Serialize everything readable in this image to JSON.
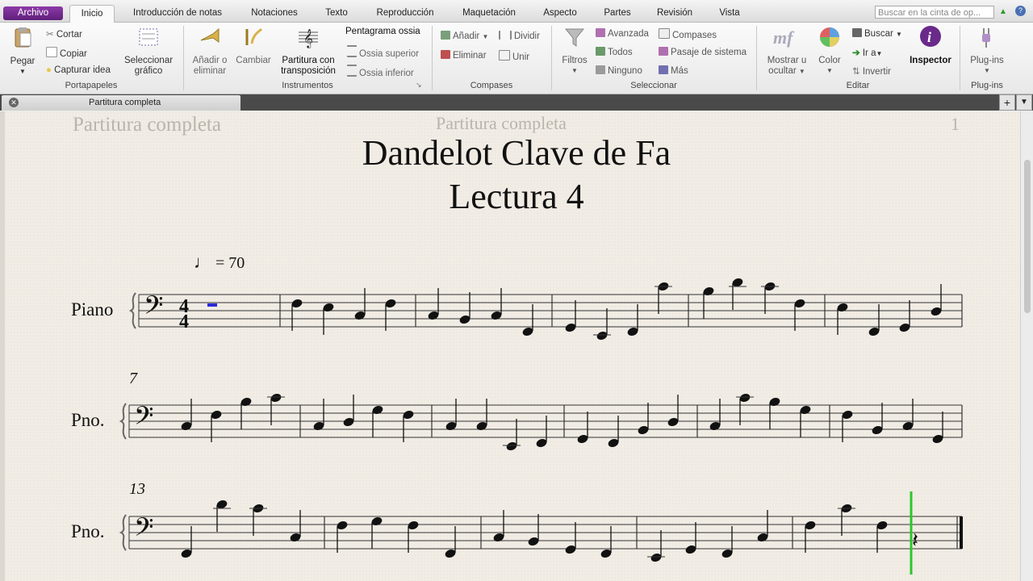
{
  "ribbon_tabs": [
    "Archivo",
    "Inicio",
    "Introducción de notas",
    "Notaciones",
    "Texto",
    "Reproducción",
    "Maquetación",
    "Aspecto",
    "Partes",
    "Revisión",
    "Vista"
  ],
  "search_placeholder": "Buscar en la cinta de op...",
  "groups": {
    "portapapeles": {
      "label": "Portapapeles",
      "pegar": "Pegar",
      "cortar": "Cortar",
      "copiar": "Copiar",
      "capturar": "Capturar idea",
      "seleccionar_grafico_1": "Seleccionar",
      "seleccionar_grafico_2": "gráfico"
    },
    "instrumentos": {
      "label": "Instrumentos",
      "anadir_1": "Añadir o",
      "anadir_2": "eliminar",
      "cambiar": "Cambiar",
      "partitura_1": "Partitura con",
      "partitura_2": "transposición",
      "pentagrama_ossia": "Pentagrama ossia",
      "ossia_superior": "Ossia superior",
      "ossia_inferior": "Ossia inferior"
    },
    "compases": {
      "label": "Compases",
      "anadir": "Añadir",
      "eliminar": "Eliminar",
      "dividir": "Dividir",
      "unir": "Unir"
    },
    "seleccionar": {
      "label": "Seleccionar",
      "filtros": "Filtros",
      "avanzada": "Avanzada",
      "todos": "Todos",
      "ninguno": "Ninguno",
      "compases": "Compases",
      "pasaje": "Pasaje de sistema",
      "mas": "Más"
    },
    "editar": {
      "label": "Editar",
      "mostrar_1": "Mostrar u",
      "mostrar_2": "ocultar",
      "color": "Color",
      "buscar": "Buscar",
      "ir_a": "Ir a",
      "invertir": "Invertir",
      "inspector": "Inspector"
    },
    "plugins": {
      "label": "Plug-ins",
      "plugins": "Plug-ins"
    }
  },
  "document_tab": "Partitura completa",
  "score": {
    "header_left": "Partitura completa",
    "header_center": "Partitura completa",
    "page_number": "1",
    "title": "Dandelot Clave de Fa",
    "subtitle": "Lectura 4",
    "tempo": "= 70",
    "time_signature": {
      "top": "4",
      "bottom": "4"
    },
    "instrument_full": "Piano",
    "instrument_short": "Pno.",
    "system_numbers": [
      "7",
      "13"
    ]
  },
  "colors": {
    "file_tab": "#6b2589",
    "playback_line": "#2dc62d",
    "selection": "#2a2ad8",
    "paper": "#f1ece4"
  }
}
